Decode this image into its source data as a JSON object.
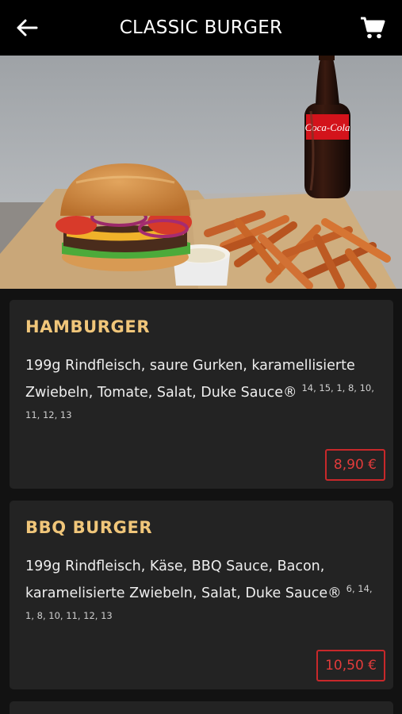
{
  "header": {
    "title": "CLASSIC BURGER",
    "back_icon": "arrow-left-icon",
    "cart_icon": "shopping-cart-icon"
  },
  "hero": {
    "bottle_label": "Coca-Cola"
  },
  "products": [
    {
      "name": "HAMBURGER",
      "description": "199g Rindfleisch, saure Gurken, karamellisierte Zwiebeln, Tomate, Salat, Duke Sauce®",
      "allergens": "14, 15, 1, 8, 10, 11, 12, 13",
      "price": "8,90 €"
    },
    {
      "name": "BBQ BURGER",
      "description": "199g Rindfleisch, Käse, BBQ Sauce, Bacon, karamelisierte Zwiebeln, Salat, Duke Sauce®",
      "allergens": "6, 14, 1, 8, 10, 11, 12, 13",
      "price": "10,50 €"
    }
  ],
  "colors": {
    "header_bg": "#000000",
    "page_bg": "#121212",
    "card_bg": "#232323",
    "product_name": "#f0c67a",
    "price_accent": "#c8282a"
  }
}
